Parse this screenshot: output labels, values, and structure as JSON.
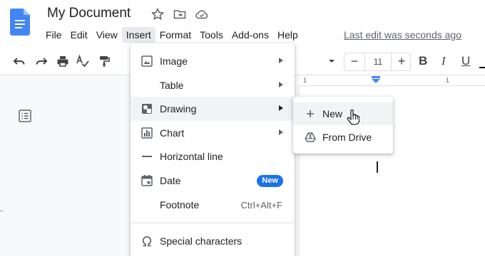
{
  "header": {
    "doc_title": "My Document",
    "last_edit": "Last edit was seconds ago",
    "icons": [
      "star-icon",
      "move-to-folder-icon",
      "cloud-saved-icon"
    ]
  },
  "menubar": {
    "items": [
      {
        "label": "File"
      },
      {
        "label": "Edit"
      },
      {
        "label": "View"
      },
      {
        "label": "Insert",
        "active": true
      },
      {
        "label": "Format"
      },
      {
        "label": "Tools"
      },
      {
        "label": "Add-ons"
      },
      {
        "label": "Help"
      }
    ]
  },
  "toolbar": {
    "icons": [
      "undo-icon",
      "redo-icon",
      "print-icon",
      "spellcheck-icon",
      "paint-format-icon"
    ],
    "font_size": "11",
    "minus": "−",
    "plus": "+",
    "bold": "B",
    "italic": "I",
    "underline": "U"
  },
  "ruler": {
    "labels": [
      "1",
      "1"
    ]
  },
  "insert_menu": {
    "items": [
      {
        "label": "Image",
        "icon": "image-icon",
        "submenu": true
      },
      {
        "label": "Table",
        "icon": "",
        "submenu": true
      },
      {
        "label": "Drawing",
        "icon": "drawing-icon",
        "submenu": true,
        "hover": true
      },
      {
        "label": "Chart",
        "icon": "chart-icon",
        "submenu": true
      },
      {
        "label": "Horizontal line",
        "icon": "horizontal-line-icon"
      },
      {
        "label": "Date",
        "icon": "date-icon",
        "badge": "New"
      },
      {
        "label": "Footnote",
        "shortcut": "Ctrl+Alt+F"
      },
      {
        "label": "Special characters",
        "icon": "omega-icon"
      }
    ]
  },
  "drawing_submenu": {
    "items": [
      {
        "label": "New",
        "icon": "plus-icon",
        "hover": true
      },
      {
        "label": "From Drive",
        "icon": "drive-icon"
      }
    ]
  },
  "colors": {
    "docs_blue": "#4285f4",
    "badge_blue": "#1a73e8",
    "hover_gray": "#f1f3f4",
    "active_menu_gray": "#e8eaed"
  }
}
